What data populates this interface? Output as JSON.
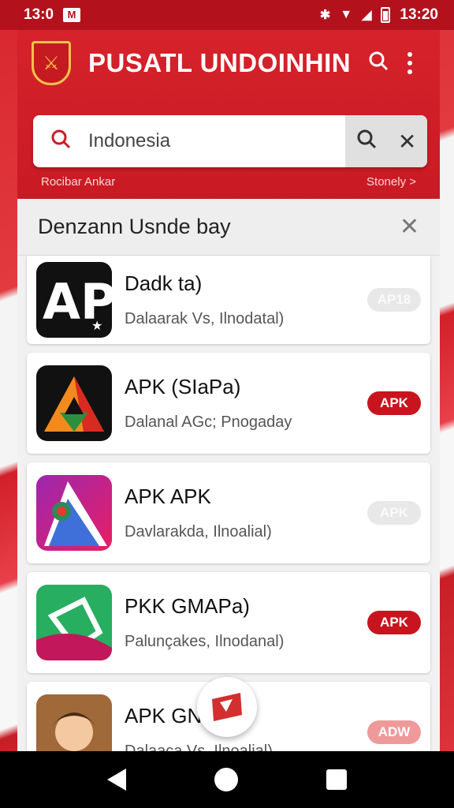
{
  "status": {
    "time_left": "13:0",
    "time_right": "13:20"
  },
  "appbar": {
    "title": "PUSATL UNDOINHIN"
  },
  "search": {
    "value": "Indonesia",
    "sub_left": "Rocibar Ankar",
    "sub_right": "Stonely >"
  },
  "panel": {
    "title": "Denzann Usnde bay"
  },
  "items": [
    {
      "name": "Dadk ta)",
      "desc": "Dalaarak Vs, Ilnodatal)",
      "badge": "AP18"
    },
    {
      "name": "APK (SIaPa)",
      "desc": "Dalanal AGc; Pnogaday",
      "badge": "APK"
    },
    {
      "name": "APK APK",
      "desc": "Davlarakda, Ilnoalial)",
      "badge": "APK"
    },
    {
      "name": "PKK GMAPa)",
      "desc": "Palunçakes, Ilnodanal)",
      "badge": "APK"
    },
    {
      "name": "APK GN",
      "desc": "Dalaaca Vs, Ilnoalial)",
      "badge": "ADW"
    }
  ],
  "colors": {
    "brand": "#c8141e",
    "appbar": "#d6222b"
  },
  "icons": {
    "search": "search-icon",
    "menu": "kebab-menu-icon",
    "clear": "close-icon"
  }
}
